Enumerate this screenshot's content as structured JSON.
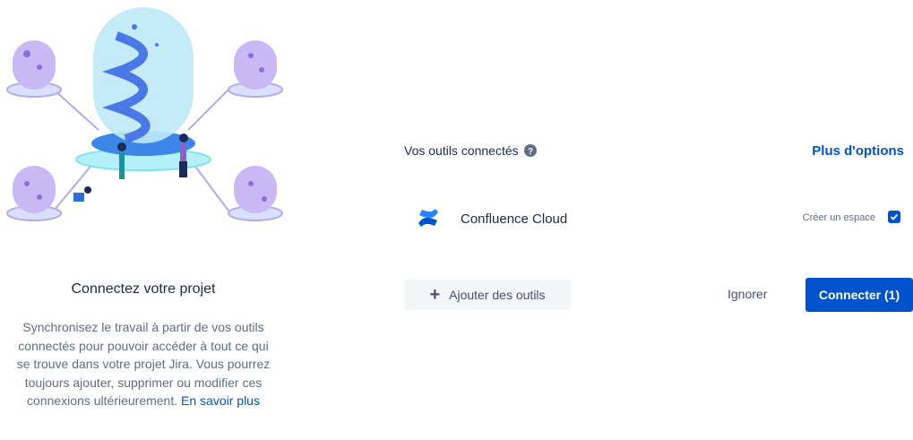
{
  "intro": {
    "title": "Connectez votre projet",
    "description": "Synchronisez le travail à partir de vos outils connectés pour pouvoir accéder à tout ce qui se trouve dans votre projet Jira. Vous pourrez toujours ajouter, supprimer ou modifier ces connexions ultérieurement.",
    "learn_more": "En savoir plus"
  },
  "tools": {
    "section_title": "Vos outils connectés",
    "more_options": "Plus d'options",
    "items": [
      {
        "name": "Confluence Cloud",
        "option_label": "Créer un espace",
        "checked": true,
        "icon": "confluence-logo-icon"
      }
    ],
    "add_label": "Ajouter des outils"
  },
  "actions": {
    "ignore_label": "Ignorer",
    "connect_label": "Connecter (1)"
  },
  "colors": {
    "primary": "#0052cc",
    "text": "#172b4d",
    "subtle": "#5e6c84",
    "illustration_purple": "#b6a6ea",
    "illustration_blue": "#4a90e8"
  }
}
